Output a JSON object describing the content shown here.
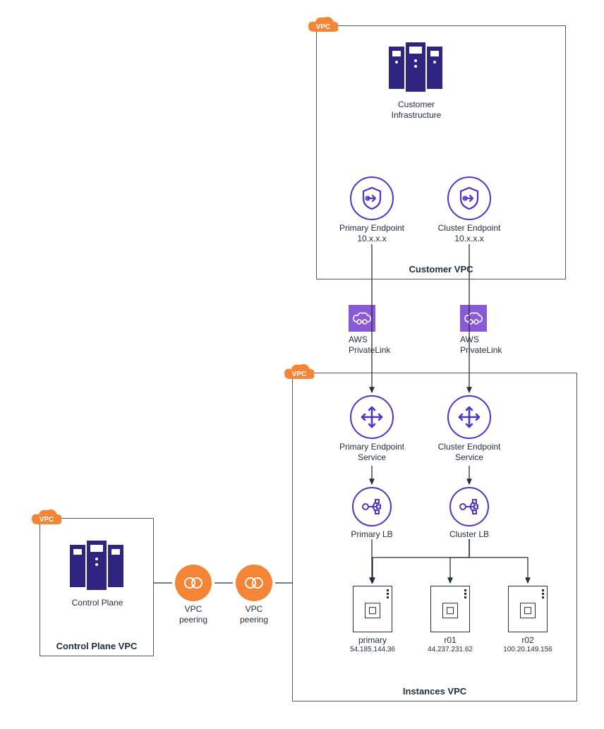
{
  "customer_vpc": {
    "badge": "VPC",
    "title": "Customer VPC",
    "infra_label": "Customer\nInfrastructure",
    "primary_ep_label": "Primary Endpoint\n10.x.x.x",
    "cluster_ep_label": "Cluster Endpoint\n10.x.x.x"
  },
  "privatelink": {
    "left_label": "AWS\nPrivateLink",
    "right_label": "AWS\nPrivateLink"
  },
  "instances_vpc": {
    "badge": "VPC",
    "title": "Instances VPC",
    "primary_eps_label": "Primary Endpoint\nService",
    "cluster_eps_label": "Cluster Endpoint\nService",
    "primary_lb_label": "Primary LB",
    "cluster_lb_label": "Cluster LB",
    "instances": [
      {
        "name": "primary",
        "ip": "54.185.144.36"
      },
      {
        "name": "r01",
        "ip": "44.237.231.62"
      },
      {
        "name": "r02",
        "ip": "100.20.149.156"
      }
    ]
  },
  "control_vpc": {
    "badge": "VPC",
    "title": "Control Plane VPC",
    "label": "Control Plane"
  },
  "peering": {
    "left_label": "VPC\npeering",
    "right_label": "VPC\npeering"
  }
}
